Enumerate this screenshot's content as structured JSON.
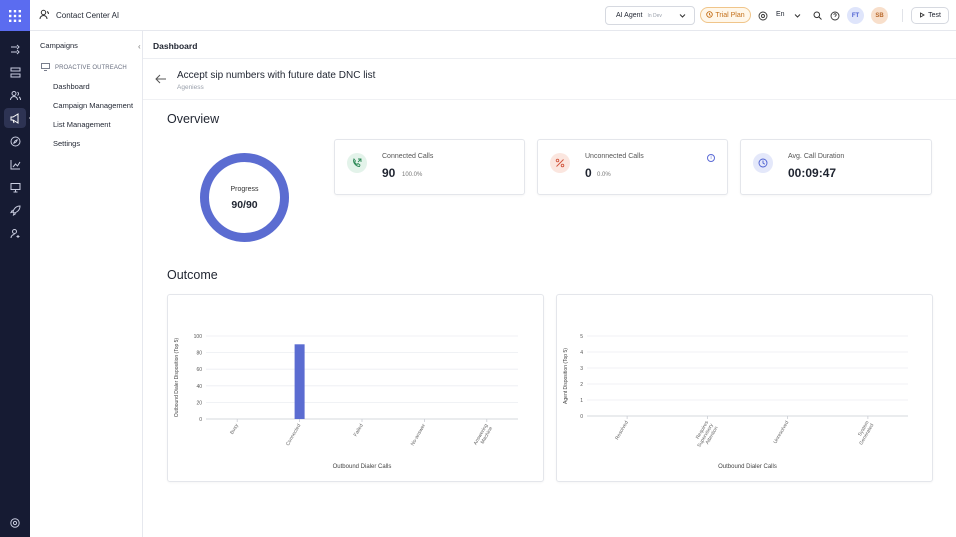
{
  "app": {
    "title": "Contact Center AI"
  },
  "topbar": {
    "agent_select": {
      "label": "AI Agent",
      "env": "In Dev"
    },
    "trial_label": "Trial Plan",
    "language": "En",
    "avatar1": "FT",
    "avatar2": "SB",
    "test_label": "Test"
  },
  "sidebar": {
    "title": "Campaigns",
    "section": "PROACTIVE OUTREACH",
    "items": [
      {
        "label": "Dashboard"
      },
      {
        "label": "Campaign Management"
      },
      {
        "label": "List Management"
      },
      {
        "label": "Settings"
      }
    ]
  },
  "main": {
    "header": "Dashboard",
    "page_title": "Accept sip numbers with future date DNC list",
    "page_subtitle": "Ageniess",
    "overview_title": "Overview",
    "outcome_title": "Outcome",
    "progress": {
      "label": "Progress",
      "value": "90/90",
      "fraction": 1.0
    },
    "cards": [
      {
        "label": "Connected Calls",
        "value": "90",
        "pct": "100.0%"
      },
      {
        "label": "Unconnected Calls",
        "value": "0",
        "pct": "0.0%"
      },
      {
        "label": "Avg. Call Duration",
        "value": "00:09:47"
      }
    ]
  },
  "colors": {
    "accent": "#5b6cd1",
    "rail": "#161b33",
    "trial": "#c4701a"
  },
  "chart_data": [
    {
      "type": "bar",
      "ylabel": "Outbound Dialer Disposition (Top 5)",
      "xlabel": "Outbound Dialer Calls",
      "categories": [
        "Busy",
        "Connected",
        "Failed",
        "No-answer",
        "Answering Machine"
      ],
      "values": [
        0,
        90,
        0,
        0,
        0
      ],
      "yticks": [
        "0",
        "20",
        "40",
        "60",
        "80",
        "100"
      ],
      "ylim": [
        0,
        100
      ],
      "color": "#5b6cd1",
      "grid": true
    },
    {
      "type": "bar",
      "ylabel": "Agent Disposition (Top 5)",
      "xlabel": "Outbound Dialer Calls",
      "categories": [
        "Resolved",
        "Requires Supervisory Attention",
        "Unresolved",
        "System Generated"
      ],
      "values": [
        0,
        0,
        0,
        0
      ],
      "yticks": [
        "0",
        "1",
        "2",
        "3",
        "4",
        "5"
      ],
      "ylim": [
        0,
        5
      ],
      "color": "#5b6cd1",
      "grid": true
    }
  ]
}
